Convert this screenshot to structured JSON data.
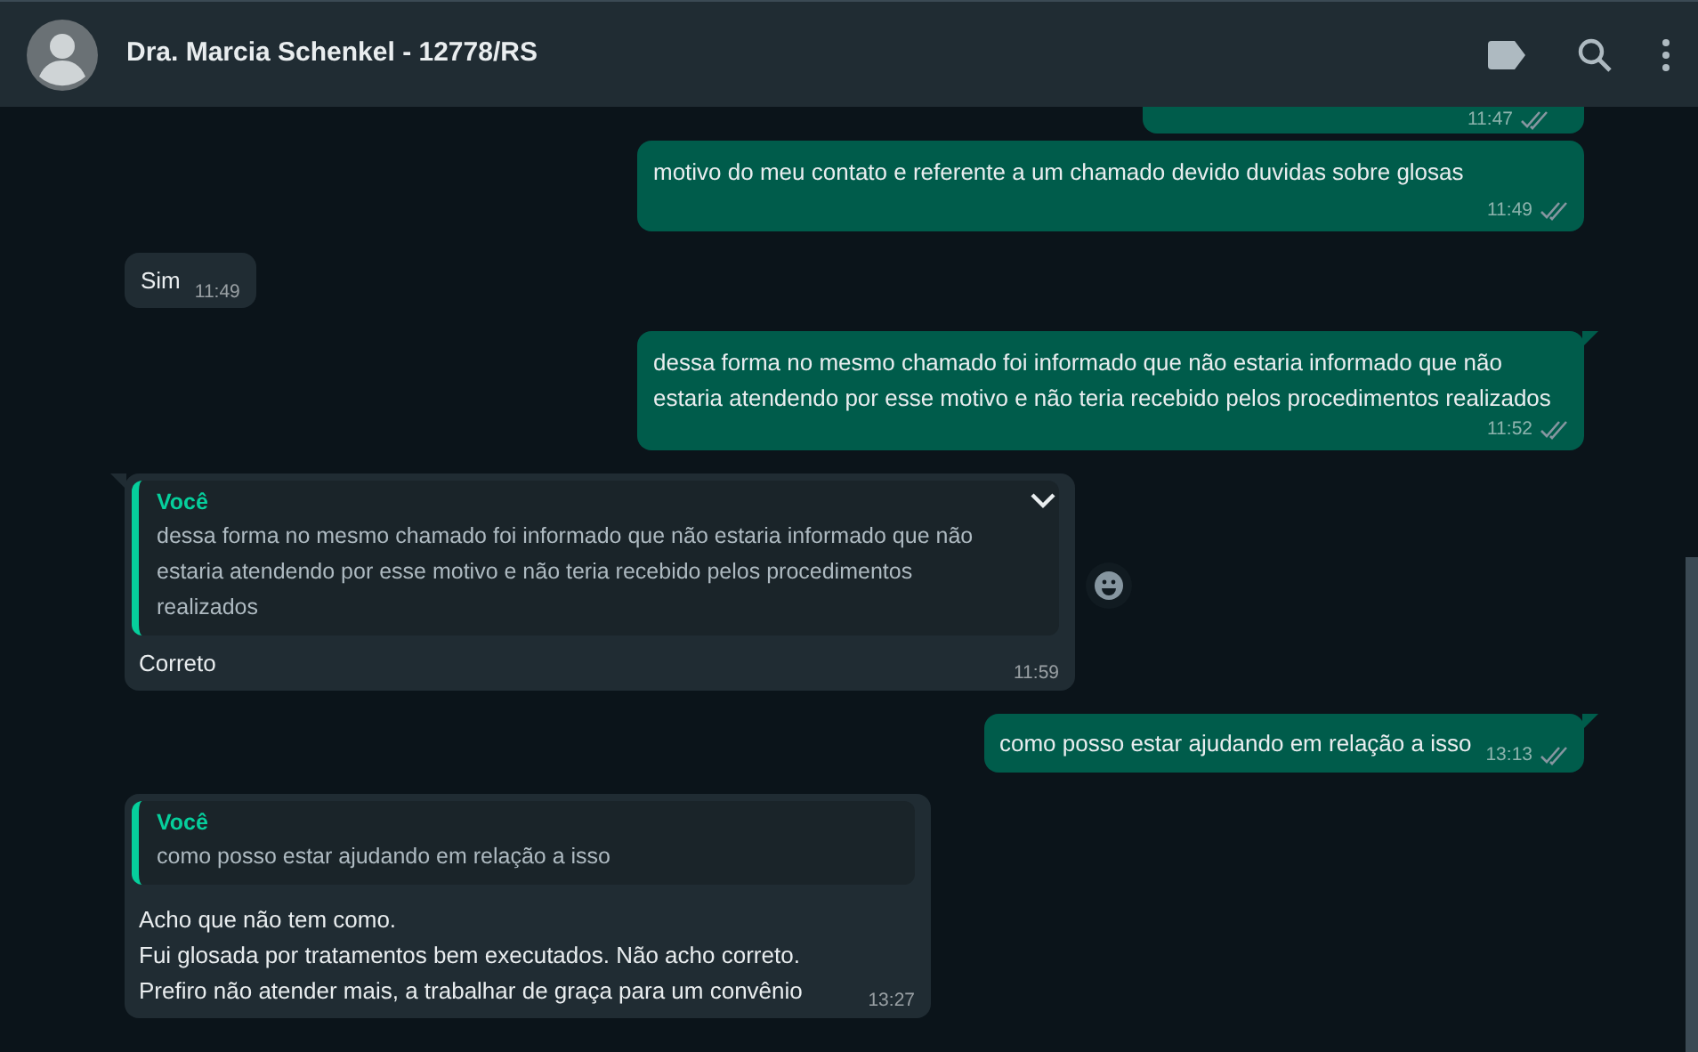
{
  "header": {
    "title": "Dra. Marcia Schenkel - 12778/RS"
  },
  "messages": [
    {
      "kind": "partial",
      "outgoing": true,
      "time": "11:47",
      "read": false
    },
    {
      "kind": "text",
      "outgoing": true,
      "text": "motivo do meu contato e referente a um chamado devido duvidas sobre glosas",
      "time": "11:49",
      "read": false
    },
    {
      "kind": "text",
      "outgoing": false,
      "text": "Sim",
      "time": "11:49"
    },
    {
      "kind": "text",
      "outgoing": true,
      "tail": true,
      "text": "dessa forma no mesmo chamado foi informado que não estaria informado que não estaria atendendo por esse motivo e não teria recebido pelos procedimentos realizados",
      "time": "11:52",
      "read": false
    },
    {
      "kind": "reply",
      "outgoing": false,
      "tail": true,
      "menu": true,
      "react": true,
      "quote": {
        "author": "Você",
        "text": "dessa forma no mesmo chamado foi informado que não estaria informado que não estaria atendendo por esse motivo e não teria recebido pelos procedimentos realizados"
      },
      "text": "Correto",
      "time": "11:59"
    },
    {
      "kind": "text",
      "outgoing": true,
      "tail": true,
      "text": "como posso estar ajudando em relação a isso",
      "time": "13:13",
      "read": false
    },
    {
      "kind": "reply",
      "outgoing": false,
      "quote": {
        "author": "Você",
        "text": "como posso estar ajudando em relação a isso"
      },
      "lines": [
        "Acho que não tem como.",
        "Fui glosada por tratamentos bem executados. Não acho correto.",
        "Prefiro não atender mais, a trabalhar de graça para um convênio"
      ],
      "time": "13:27"
    }
  ]
}
